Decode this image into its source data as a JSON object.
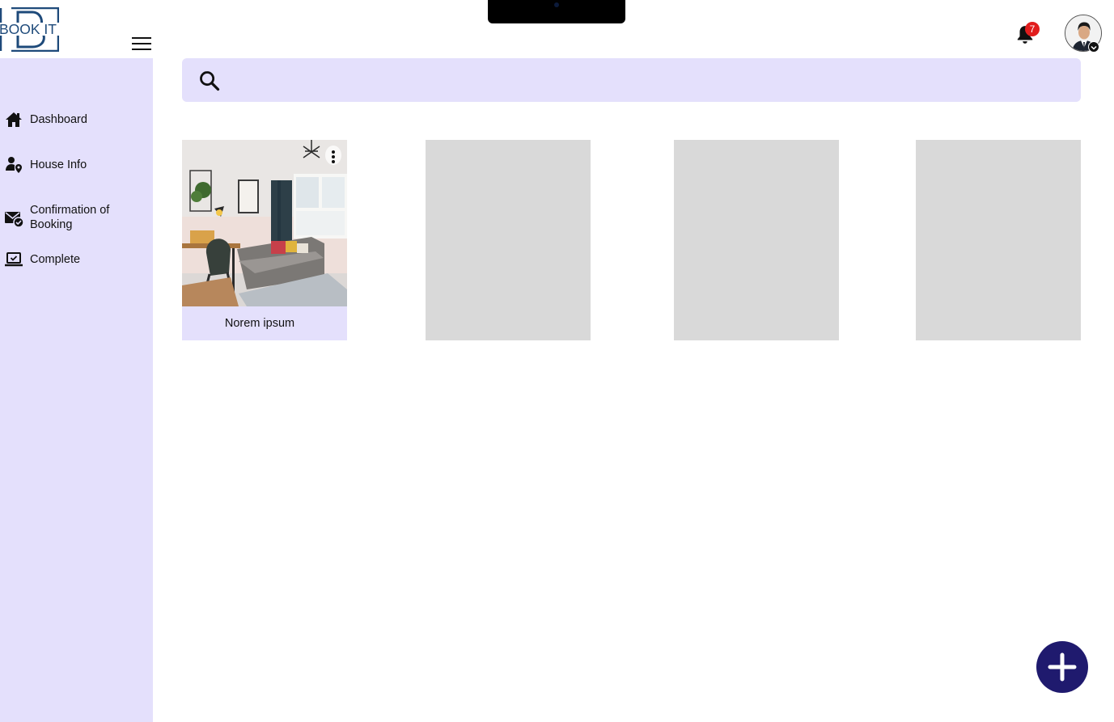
{
  "app": {
    "logo_text": "BOOK IT",
    "brand_color": "#1e4a7a"
  },
  "sidebar": {
    "items": [
      {
        "label": "Dashboard",
        "icon": "home-icon"
      },
      {
        "label": "House Info",
        "icon": "user-location-icon"
      },
      {
        "label": "Confirmation of Booking",
        "icon": "mail-check-icon"
      },
      {
        "label": "Complete",
        "icon": "laptop-check-icon"
      }
    ]
  },
  "header": {
    "notification_count": "7"
  },
  "search": {
    "value": "",
    "placeholder": ""
  },
  "cards": [
    {
      "title": "Norem ipsum",
      "has_image": true
    },
    {
      "title": "",
      "has_image": false
    },
    {
      "title": "",
      "has_image": false
    },
    {
      "title": "",
      "has_image": false
    }
  ],
  "colors": {
    "sidebar_bg": "#e4e0fc",
    "placeholder_card": "#d9d9d9",
    "fab": "#1f1a6e",
    "badge": "#e11d1d"
  }
}
